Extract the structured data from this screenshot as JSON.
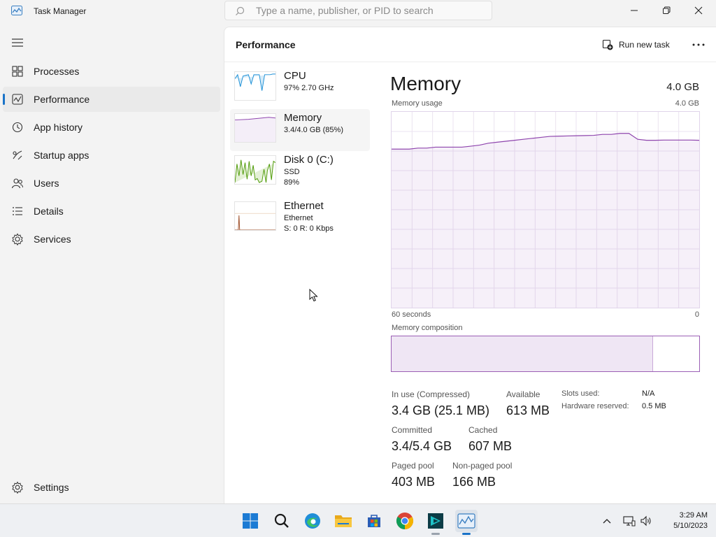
{
  "window": {
    "title": "Task Manager",
    "search_placeholder": "Type a name, publisher, or PID to search"
  },
  "nav": {
    "items": [
      {
        "label": "Processes",
        "icon": "processes-icon"
      },
      {
        "label": "Performance",
        "icon": "performance-icon",
        "active": true
      },
      {
        "label": "App history",
        "icon": "history-icon"
      },
      {
        "label": "Startup apps",
        "icon": "startup-icon"
      },
      {
        "label": "Users",
        "icon": "users-icon"
      },
      {
        "label": "Details",
        "icon": "details-icon"
      },
      {
        "label": "Services",
        "icon": "services-icon"
      }
    ],
    "settings_label": "Settings"
  },
  "header": {
    "title": "Performance",
    "run_new_task": "Run new task"
  },
  "resources": [
    {
      "title": "CPU",
      "line1": "97%  2.70 GHz",
      "line2": "",
      "line3": "",
      "color": "#1a8fd6"
    },
    {
      "title": "Memory",
      "line1": "3.4/4.0 GB (85%)",
      "line2": "",
      "line3": "",
      "color": "#8e44ad"
    },
    {
      "title": "Disk 0 (C:)",
      "line1": "SSD",
      "line2": "89%",
      "line3": "",
      "color": "#4e9a06"
    },
    {
      "title": "Ethernet",
      "line1": "Ethernet",
      "line2": "S: 0  R: 0 Kbps",
      "line3": "",
      "color": "#a0522d"
    }
  ],
  "detail": {
    "title": "Memory",
    "total": "4.0 GB",
    "usage_label": "Memory usage",
    "usage_max": "4.0 GB",
    "time_left": "60 seconds",
    "time_right": "0",
    "composition_label": "Memory composition",
    "composition_used_fraction": 0.85,
    "accent": "#8e44ad"
  },
  "stats": {
    "in_use_label": "In use (Compressed)",
    "in_use_value": "3.4 GB (25.1 MB)",
    "available_label": "Available",
    "available_value": "613 MB",
    "committed_label": "Committed",
    "committed_value": "3.4/5.4 GB",
    "cached_label": "Cached",
    "cached_value": "607 MB",
    "paged_label": "Paged pool",
    "paged_value": "403 MB",
    "nonpaged_label": "Non-paged pool",
    "nonpaged_value": "166 MB",
    "slots_label": "Slots used:",
    "slots_value": "N/A",
    "hw_label": "Hardware reserved:",
    "hw_value": "0.5 MB"
  },
  "memory_usage_series": [
    0.81,
    0.81,
    0.81,
    0.815,
    0.815,
    0.82,
    0.82,
    0.82,
    0.82,
    0.825,
    0.83,
    0.84,
    0.845,
    0.85,
    0.855,
    0.86,
    0.865,
    0.87,
    0.875,
    0.876,
    0.877,
    0.878,
    0.879,
    0.88,
    0.885,
    0.885,
    0.89,
    0.89,
    0.86,
    0.855,
    0.855,
    0.856,
    0.856,
    0.856,
    0.856,
    0.855
  ],
  "taskbar": {
    "time": "3:29 AM",
    "date": "5/10/2023",
    "apps": [
      "start-icon",
      "search-icon",
      "edge-icon",
      "file-explorer-icon",
      "store-icon",
      "chrome-icon",
      "app-icon",
      "task-manager-icon"
    ]
  }
}
